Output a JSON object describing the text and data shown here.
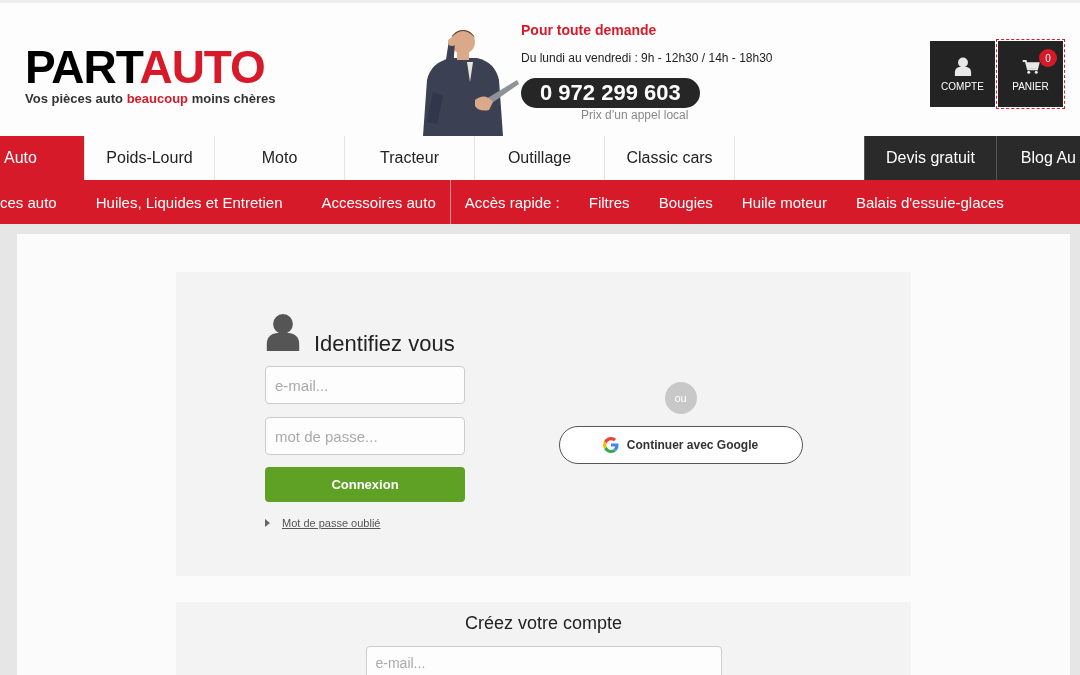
{
  "header": {
    "logo": {
      "dark": "PART",
      "red": "AUTO"
    },
    "tagline": {
      "before": "Vos pièces auto ",
      "highlight": "beaucoup",
      "after": " moins chères"
    },
    "contact": {
      "title": "Pour toute demande",
      "hours": "Du lundi au vendredi : 9h - 12h30 / 14h - 18h30",
      "phone": "0 972 299 603",
      "note": "Prix d’un appel local"
    },
    "buttons": [
      {
        "kind": "account",
        "label": "COMPTE"
      },
      {
        "kind": "cart",
        "label": "PANIER",
        "badge": "0"
      }
    ]
  },
  "main_nav": {
    "tabs": [
      {
        "label": "Auto",
        "selected": true
      },
      {
        "label": "Poids-Lourd",
        "selected": false
      },
      {
        "label": "Moto",
        "selected": false
      },
      {
        "label": "Tracteur",
        "selected": false
      },
      {
        "label": "Outillage",
        "selected": false
      },
      {
        "label": "Classic cars",
        "selected": false
      }
    ],
    "extra": [
      {
        "label": "Devis gratuit"
      },
      {
        "label": "Blog Au"
      }
    ]
  },
  "sub_nav": {
    "links": [
      "ces auto",
      "Huiles, Liquides et Entretien",
      "Accessoires auto"
    ],
    "quick_label": "Accès rapide :",
    "quick_links": [
      "Filtres",
      "Bougies",
      "Huile moteur",
      "Balais d'essuie-glaces"
    ]
  },
  "login": {
    "title": "Identifiez vous",
    "email_placeholder": "e-mail...",
    "password_placeholder": "mot de passe...",
    "submit": "Connexion",
    "forgot": "Mot de passe oublié",
    "separator": "ou",
    "google": "Continuer avec Google"
  },
  "create": {
    "title": "Créez votre compte",
    "email_placeholder": "e-mail..."
  }
}
